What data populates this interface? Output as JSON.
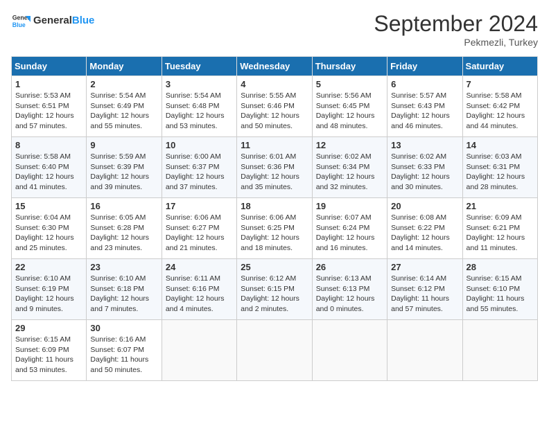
{
  "header": {
    "logo_line1": "General",
    "logo_line2": "Blue",
    "month_title": "September 2024",
    "location": "Pekmezli, Turkey"
  },
  "weekdays": [
    "Sunday",
    "Monday",
    "Tuesday",
    "Wednesday",
    "Thursday",
    "Friday",
    "Saturday"
  ],
  "weeks": [
    [
      {
        "day": "1",
        "info": "Sunrise: 5:53 AM\nSunset: 6:51 PM\nDaylight: 12 hours\nand 57 minutes."
      },
      {
        "day": "2",
        "info": "Sunrise: 5:54 AM\nSunset: 6:49 PM\nDaylight: 12 hours\nand 55 minutes."
      },
      {
        "day": "3",
        "info": "Sunrise: 5:54 AM\nSunset: 6:48 PM\nDaylight: 12 hours\nand 53 minutes."
      },
      {
        "day": "4",
        "info": "Sunrise: 5:55 AM\nSunset: 6:46 PM\nDaylight: 12 hours\nand 50 minutes."
      },
      {
        "day": "5",
        "info": "Sunrise: 5:56 AM\nSunset: 6:45 PM\nDaylight: 12 hours\nand 48 minutes."
      },
      {
        "day": "6",
        "info": "Sunrise: 5:57 AM\nSunset: 6:43 PM\nDaylight: 12 hours\nand 46 minutes."
      },
      {
        "day": "7",
        "info": "Sunrise: 5:58 AM\nSunset: 6:42 PM\nDaylight: 12 hours\nand 44 minutes."
      }
    ],
    [
      {
        "day": "8",
        "info": "Sunrise: 5:58 AM\nSunset: 6:40 PM\nDaylight: 12 hours\nand 41 minutes."
      },
      {
        "day": "9",
        "info": "Sunrise: 5:59 AM\nSunset: 6:39 PM\nDaylight: 12 hours\nand 39 minutes."
      },
      {
        "day": "10",
        "info": "Sunrise: 6:00 AM\nSunset: 6:37 PM\nDaylight: 12 hours\nand 37 minutes."
      },
      {
        "day": "11",
        "info": "Sunrise: 6:01 AM\nSunset: 6:36 PM\nDaylight: 12 hours\nand 35 minutes."
      },
      {
        "day": "12",
        "info": "Sunrise: 6:02 AM\nSunset: 6:34 PM\nDaylight: 12 hours\nand 32 minutes."
      },
      {
        "day": "13",
        "info": "Sunrise: 6:02 AM\nSunset: 6:33 PM\nDaylight: 12 hours\nand 30 minutes."
      },
      {
        "day": "14",
        "info": "Sunrise: 6:03 AM\nSunset: 6:31 PM\nDaylight: 12 hours\nand 28 minutes."
      }
    ],
    [
      {
        "day": "15",
        "info": "Sunrise: 6:04 AM\nSunset: 6:30 PM\nDaylight: 12 hours\nand 25 minutes."
      },
      {
        "day": "16",
        "info": "Sunrise: 6:05 AM\nSunset: 6:28 PM\nDaylight: 12 hours\nand 23 minutes."
      },
      {
        "day": "17",
        "info": "Sunrise: 6:06 AM\nSunset: 6:27 PM\nDaylight: 12 hours\nand 21 minutes."
      },
      {
        "day": "18",
        "info": "Sunrise: 6:06 AM\nSunset: 6:25 PM\nDaylight: 12 hours\nand 18 minutes."
      },
      {
        "day": "19",
        "info": "Sunrise: 6:07 AM\nSunset: 6:24 PM\nDaylight: 12 hours\nand 16 minutes."
      },
      {
        "day": "20",
        "info": "Sunrise: 6:08 AM\nSunset: 6:22 PM\nDaylight: 12 hours\nand 14 minutes."
      },
      {
        "day": "21",
        "info": "Sunrise: 6:09 AM\nSunset: 6:21 PM\nDaylight: 12 hours\nand 11 minutes."
      }
    ],
    [
      {
        "day": "22",
        "info": "Sunrise: 6:10 AM\nSunset: 6:19 PM\nDaylight: 12 hours\nand 9 minutes."
      },
      {
        "day": "23",
        "info": "Sunrise: 6:10 AM\nSunset: 6:18 PM\nDaylight: 12 hours\nand 7 minutes."
      },
      {
        "day": "24",
        "info": "Sunrise: 6:11 AM\nSunset: 6:16 PM\nDaylight: 12 hours\nand 4 minutes."
      },
      {
        "day": "25",
        "info": "Sunrise: 6:12 AM\nSunset: 6:15 PM\nDaylight: 12 hours\nand 2 minutes."
      },
      {
        "day": "26",
        "info": "Sunrise: 6:13 AM\nSunset: 6:13 PM\nDaylight: 12 hours\nand 0 minutes."
      },
      {
        "day": "27",
        "info": "Sunrise: 6:14 AM\nSunset: 6:12 PM\nDaylight: 11 hours\nand 57 minutes."
      },
      {
        "day": "28",
        "info": "Sunrise: 6:15 AM\nSunset: 6:10 PM\nDaylight: 11 hours\nand 55 minutes."
      }
    ],
    [
      {
        "day": "29",
        "info": "Sunrise: 6:15 AM\nSunset: 6:09 PM\nDaylight: 11 hours\nand 53 minutes."
      },
      {
        "day": "30",
        "info": "Sunrise: 6:16 AM\nSunset: 6:07 PM\nDaylight: 11 hours\nand 50 minutes."
      },
      {
        "day": "",
        "info": ""
      },
      {
        "day": "",
        "info": ""
      },
      {
        "day": "",
        "info": ""
      },
      {
        "day": "",
        "info": ""
      },
      {
        "day": "",
        "info": ""
      }
    ]
  ]
}
